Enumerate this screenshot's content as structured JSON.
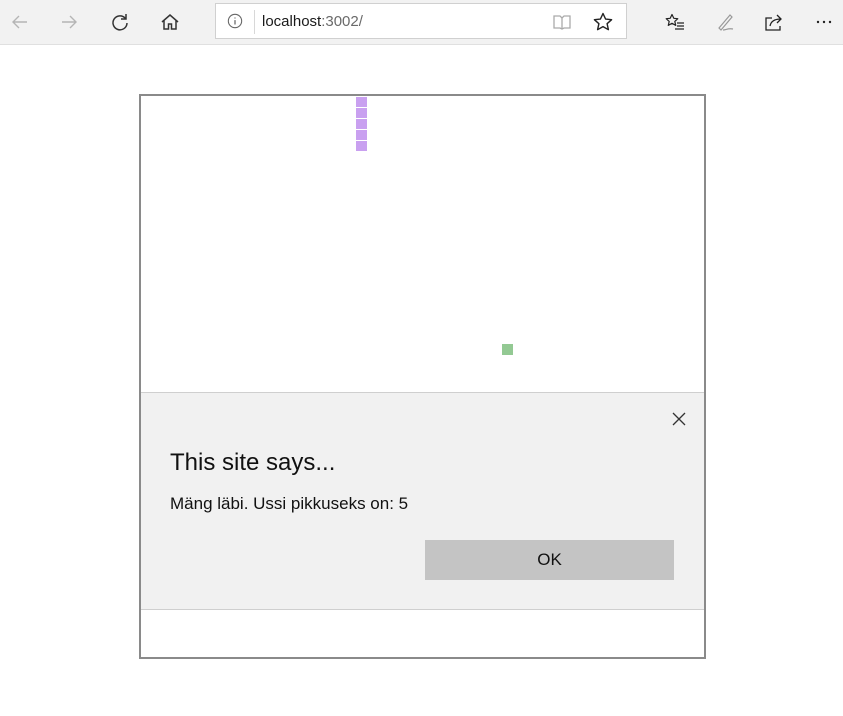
{
  "browser": {
    "url_host": "localhost",
    "url_rest": ":3002/",
    "icons": [
      "back-icon",
      "forward-icon",
      "refresh-icon",
      "home-icon",
      "info-icon",
      "reading-view-icon",
      "favorite-star-icon",
      "favorites-list-icon",
      "pen-icon",
      "share-icon",
      "more-icon"
    ]
  },
  "game": {
    "snake_color": "#c9a0f0",
    "food_color": "#93c993",
    "snake_length": 5
  },
  "dialog": {
    "title": "This site says...",
    "message": "Mäng läbi. Ussi pikkuseks on: 5",
    "ok_label": "OK"
  }
}
